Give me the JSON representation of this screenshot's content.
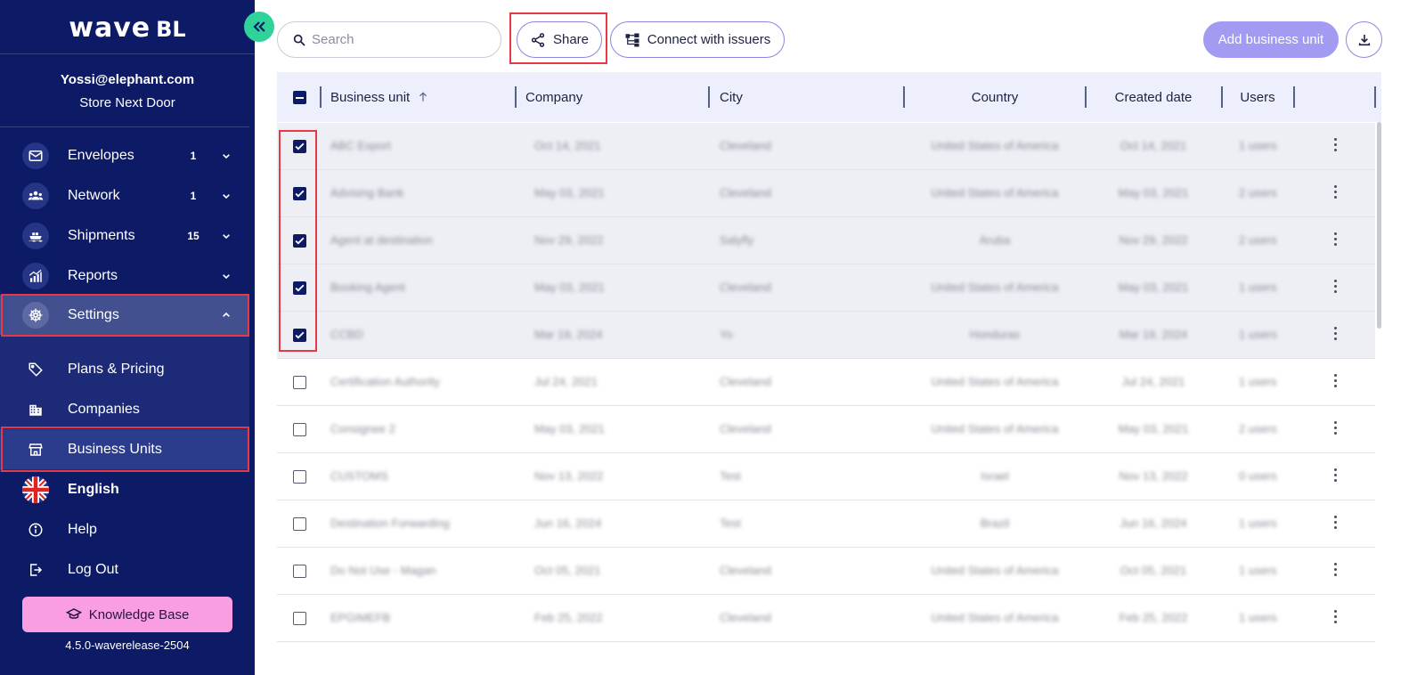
{
  "sidebar": {
    "logo_main": "wave",
    "logo_suffix": "BL",
    "user_email": "Yossi@elephant.com",
    "user_store": "Store Next Door",
    "items": [
      {
        "label": "Envelopes",
        "count": "1",
        "icon": "envelope-icon"
      },
      {
        "label": "Network",
        "count": "1",
        "icon": "network-icon"
      },
      {
        "label": "Shipments",
        "count": "15",
        "icon": "ship-icon"
      },
      {
        "label": "Reports",
        "count": "",
        "icon": "reports-icon"
      },
      {
        "label": "Settings",
        "count": "",
        "icon": "settings-wheel-icon"
      }
    ],
    "sub_items": [
      {
        "label": "Plans & Pricing",
        "icon": "tag-icon"
      },
      {
        "label": "Companies",
        "icon": "building-icon"
      },
      {
        "label": "Business Units",
        "icon": "store-icon"
      }
    ],
    "bottom_items": [
      {
        "label": "English",
        "icon": "uk-flag-icon"
      },
      {
        "label": "Help",
        "icon": "info-icon"
      },
      {
        "label": "Log Out",
        "icon": "logout-icon"
      }
    ],
    "knowledge_base": "Knowledge Base",
    "version": "4.5.0-waverelease-2504"
  },
  "toolbar": {
    "search_placeholder": "Search",
    "share_label": "Share",
    "connect_label": "Connect with issuers",
    "add_label": "Add business unit"
  },
  "table": {
    "columns": [
      "Business unit",
      "Company",
      "City",
      "Country",
      "Created date",
      "Users"
    ],
    "rows": [
      {
        "checked": true,
        "unit": "ABC Export",
        "date": "Oct 14, 2021",
        "city": "Cleveland",
        "country": "United States of America",
        "created": "Oct 14, 2021",
        "users": "1 users"
      },
      {
        "checked": true,
        "unit": "Advising Bank",
        "date": "May 03, 2021",
        "city": "Cleveland",
        "country": "United States of America",
        "created": "May 03, 2021",
        "users": "2 users"
      },
      {
        "checked": true,
        "unit": "Agent at destination",
        "date": "Nov 29, 2022",
        "city": "Salyfly",
        "country": "Aruba",
        "created": "Nov 29, 2022",
        "users": "2 users"
      },
      {
        "checked": true,
        "unit": "Booking Agent",
        "date": "May 03, 2021",
        "city": "Cleveland",
        "country": "United States of America",
        "created": "May 03, 2021",
        "users": "1 users"
      },
      {
        "checked": true,
        "unit": "CCBD",
        "date": "Mar 19, 2024",
        "city": "Yo",
        "country": "Honduras",
        "created": "Mar 19, 2024",
        "users": "1 users"
      },
      {
        "checked": false,
        "unit": "Certification Authority",
        "date": "Jul 24, 2021",
        "city": "Cleveland",
        "country": "United States of America",
        "created": "Jul 24, 2021",
        "users": "1 users"
      },
      {
        "checked": false,
        "unit": "Consignee 2",
        "date": "May 03, 2021",
        "city": "Cleveland",
        "country": "United States of America",
        "created": "May 03, 2021",
        "users": "2 users"
      },
      {
        "checked": false,
        "unit": "CUSTOMS",
        "date": "Nov 13, 2022",
        "city": "Test",
        "country": "Israel",
        "created": "Nov 13, 2022",
        "users": "0 users"
      },
      {
        "checked": false,
        "unit": "Destination Forwarding",
        "date": "Jun 16, 2024",
        "city": "Test",
        "country": "Brazil",
        "created": "Jun 16, 2024",
        "users": "1 users"
      },
      {
        "checked": false,
        "unit": "Do Not Use - Magan",
        "date": "Oct 05, 2021",
        "city": "Cleveland",
        "country": "United States of America",
        "created": "Oct 05, 2021",
        "users": "1 users"
      },
      {
        "checked": false,
        "unit": "EPGIMEFB",
        "date": "Feb 25, 2022",
        "city": "Cleveland",
        "country": "United States of America",
        "created": "Feb 25, 2022",
        "users": "1 users"
      }
    ]
  },
  "colors": {
    "sidebar_bg": "#0d1a66",
    "accent_green": "#2fd39a",
    "primary_purple": "#a39af2",
    "highlight_red": "#e53945",
    "knowledge_pink": "#f99ee3"
  }
}
